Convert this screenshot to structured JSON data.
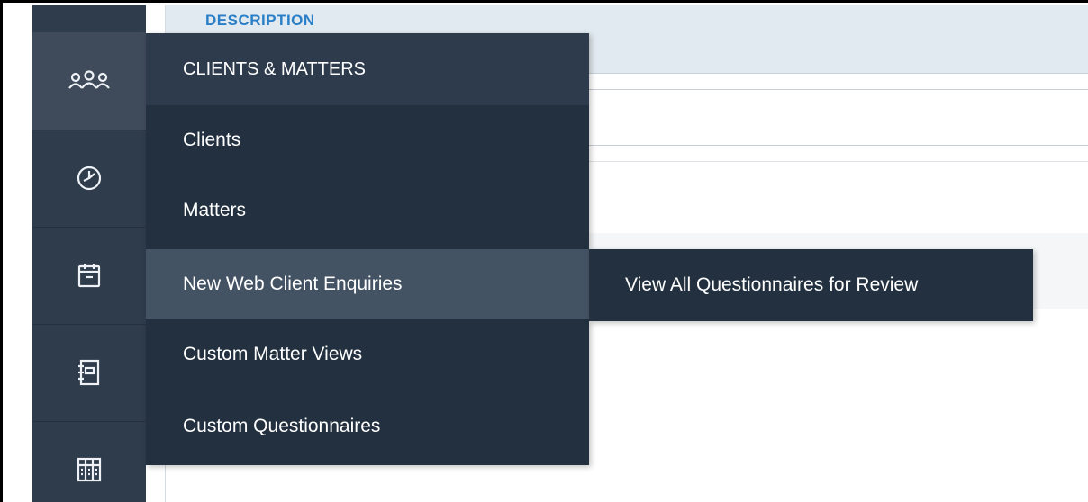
{
  "content": {
    "header_label": "DESCRIPTION"
  },
  "sidebar": {
    "items": [
      {
        "icon": "people-group-icon",
        "active": true
      },
      {
        "icon": "clock-icon",
        "active": false
      },
      {
        "icon": "calendar-icon",
        "active": false
      },
      {
        "icon": "notebook-icon",
        "active": false
      },
      {
        "icon": "library-icon",
        "active": false
      }
    ]
  },
  "menu": {
    "header": "CLIENTS & MATTERS",
    "items": [
      {
        "label": "Clients"
      },
      {
        "label": "Matters"
      },
      {
        "label": "New Web Client Enquiries",
        "hover": true
      },
      {
        "label": "Custom  Matter Views"
      },
      {
        "label": "Custom Questionnaires"
      }
    ]
  },
  "submenu": {
    "items": [
      {
        "label": "View All Questionnaires for Review"
      }
    ]
  },
  "colors": {
    "sidebar_bg": "#2f3c4c",
    "menu_bg": "#22303f",
    "menu_header_bg": "#2e3b4c",
    "hover_bg": "#445364",
    "header_row_bg": "#e1eaf0",
    "header_label": "#2b7fc7"
  }
}
